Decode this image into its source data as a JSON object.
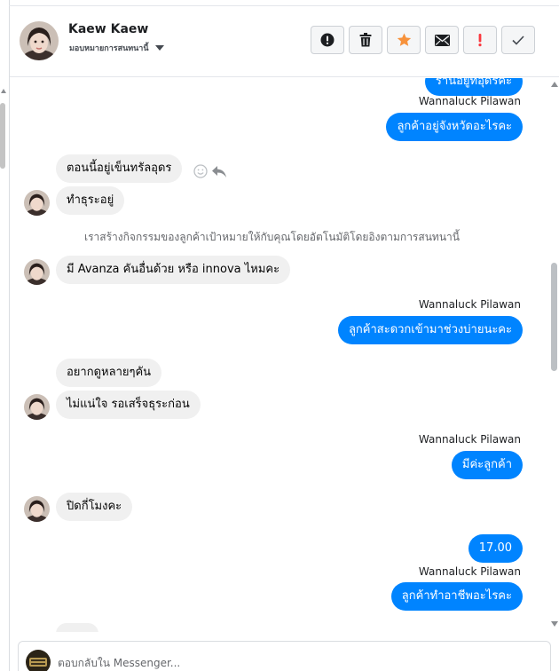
{
  "header": {
    "contact_name": "Kaew Kaew",
    "assign_label": "มอบหมายการสนทนานี้"
  },
  "actions": [
    {
      "name": "spam-button",
      "icon": "exclamation-circle-icon"
    },
    {
      "name": "delete-button",
      "icon": "trash-icon"
    },
    {
      "name": "star-button",
      "icon": "star-icon",
      "color": "#f7923b"
    },
    {
      "name": "mark-unread-button",
      "icon": "envelope-icon"
    },
    {
      "name": "follow-up-button",
      "icon": "red-exclamation-icon",
      "color": "#fa383e"
    },
    {
      "name": "mark-done-button",
      "icon": "checkmark-icon"
    }
  ],
  "colors": {
    "outgoing_bubble": "#0084ff",
    "incoming_bubble": "#f0f0f0"
  },
  "thread": {
    "m0": {
      "direction": "out",
      "text": "ร้านอยู่ที่อุดรค่ะ"
    },
    "s1": "Wannaluck Pilawan",
    "m1": {
      "direction": "out",
      "text": "ลูกค้าอยู่จังหวัดอะไรคะ"
    },
    "m2": {
      "direction": "in",
      "text": "ตอนนี้อยู่เข็นทรัลอุดร"
    },
    "m3": {
      "direction": "in",
      "text": "ทำธุระอยู่"
    },
    "system": "เราสร้างกิจกรรมของลูกค้าเป้าหมายให้กับคุณโดยอัตโนมัติโดยอิงตามการสนทนานี้",
    "m4": {
      "direction": "in",
      "text": "มี Avanza คันอื่นด้วย หรือ innova ไหมคะ"
    },
    "s5": "Wannaluck Pilawan",
    "m5": {
      "direction": "out",
      "text": "ลูกค้าสะดวกเข้ามาช่วงบ่ายนะคะ"
    },
    "m6": {
      "direction": "in",
      "text": "อยากดูหลายๆคัน"
    },
    "m7": {
      "direction": "in",
      "text": "ไม่แน่ใจ รอเสร็จธุระก่อน"
    },
    "s8": "Wannaluck Pilawan",
    "m8": {
      "direction": "out",
      "text": "มีค่ะลูกค้า"
    },
    "m9": {
      "direction": "in",
      "text": "ปิดกี่โมงคะ"
    },
    "m10": {
      "direction": "out",
      "text": "17.00"
    },
    "s11": "Wannaluck Pilawan",
    "m11": {
      "direction": "out",
      "text": "ลูกค้าทำอาชีพอะไรคะ"
    }
  },
  "composer": {
    "placeholder": "ตอบกลับใน Messenger..."
  }
}
